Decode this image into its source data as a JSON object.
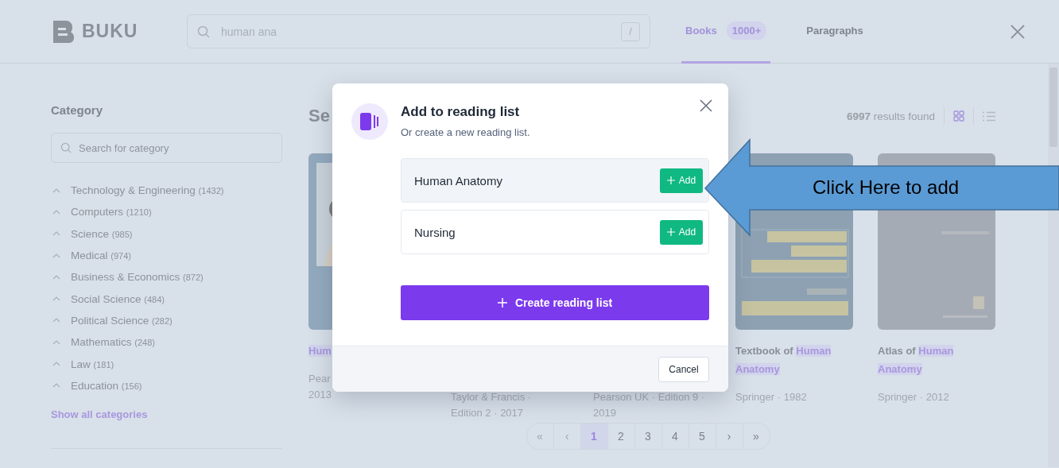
{
  "header": {
    "logo": "BUKU",
    "search": {
      "value": "human ana",
      "shortcut": "/"
    },
    "tabs": [
      {
        "label": "Books",
        "badge": "1000+",
        "selected": true
      },
      {
        "label": "Paragraphs",
        "selected": false
      }
    ]
  },
  "sidebar": {
    "title": "Category",
    "search": {
      "placeholder": "Search for category"
    },
    "categories": [
      {
        "name": "Technology & Engineering",
        "count": "(1432)"
      },
      {
        "name": "Computers",
        "count": "(1210)"
      },
      {
        "name": "Science",
        "count": "(985)"
      },
      {
        "name": "Medical",
        "count": "(974)"
      },
      {
        "name": "Business & Economics",
        "count": "(872)"
      },
      {
        "name": "Social Science",
        "count": "(484)"
      },
      {
        "name": "Political Science",
        "count": "(282)"
      },
      {
        "name": "Mathematics",
        "count": "(248)"
      },
      {
        "name": "Law",
        "count": "(181)"
      },
      {
        "name": "Education",
        "count": "(156)"
      }
    ],
    "show_all": "Show all categories"
  },
  "results": {
    "heading": "Se",
    "summary": "**6997** results found",
    "views": [
      {
        "kind": "grid",
        "selected": true
      },
      {
        "kind": "list",
        "selected": false
      }
    ],
    "books": [
      {
        "cover": {
          "kind": "picture"
        },
        "title_parts": [
          {
            "text": "Hum",
            "highlight": true
          }
        ],
        "meta": [
          "Pear",
          "2013"
        ]
      },
      {
        "meta": [
          "Taylor & Francis ·",
          "Edition 2 · 2017"
        ]
      },
      {
        "meta": [
          "Pearson UK · Edition 9 ·",
          "2019"
        ]
      },
      {
        "cover": {
          "kind": "picture"
        },
        "title_parts": [
          {
            "text": "Textbook of",
            "highlight": false
          },
          {
            "text": "Human",
            "highlight": true
          },
          {
            "text": "Anatomy",
            "highlight": true
          }
        ],
        "meta": [
          "Springer · 1982"
        ]
      },
      {
        "cover": {
          "kind": "picture"
        },
        "title_parts": [
          {
            "text": "Atlas of",
            "highlight": false
          },
          {
            "text": "Human",
            "highlight": true
          },
          {
            "text": "Anatomy",
            "highlight": true
          }
        ],
        "meta": [
          "Springer · 2012"
        ]
      }
    ],
    "pagination": [
      {
        "label": "«",
        "selected": false,
        "disabled": true
      },
      {
        "label": "‹",
        "selected": false,
        "disabled": true
      },
      {
        "label": "1",
        "selected": true,
        "disabled": false
      },
      {
        "label": "2",
        "selected": false,
        "disabled": false
      },
      {
        "label": "3",
        "selected": false,
        "disabled": false
      },
      {
        "label": "4",
        "selected": false,
        "disabled": false
      },
      {
        "label": "5",
        "selected": false,
        "disabled": false
      },
      {
        "label": "›",
        "selected": false,
        "disabled": false
      },
      {
        "label": "»",
        "selected": false,
        "disabled": false
      }
    ]
  },
  "dialog": {
    "title": "Add to reading list",
    "subtitle": "Or create a new reading list.",
    "lists": [
      {
        "name": "Human Anatomy",
        "highlighted": true,
        "action": "Add"
      },
      {
        "name": "Nursing",
        "highlighted": false,
        "action": "Add"
      }
    ],
    "create_button": "Create reading list",
    "cancel_button": "Cancel"
  },
  "annotation": {
    "text": "Click Here to add"
  }
}
